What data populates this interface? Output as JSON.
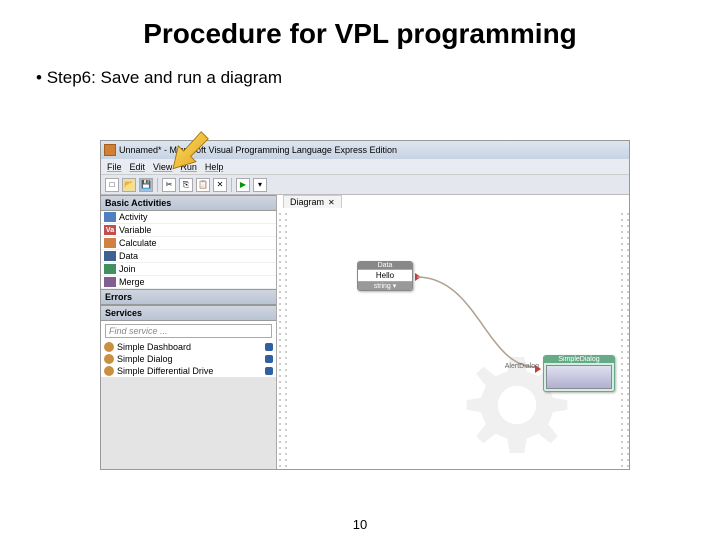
{
  "slide": {
    "title": "Procedure for VPL programming",
    "bullet": "Step6: Save and run a diagram",
    "page_number": "10"
  },
  "app": {
    "window_title": "Unnamed* - Microsoft Visual Programming Language Express Edition",
    "menubar": {
      "file": "File",
      "edit": "Edit",
      "view": "View",
      "run": "Run",
      "help": "Help"
    },
    "toolbar": {
      "new": "□",
      "open": "📂",
      "save": "💾",
      "cut": "✂",
      "copy": "⎘",
      "paste": "📋",
      "delete": "✕",
      "run": "▶"
    },
    "panels": {
      "basic_activities": {
        "header": "Basic Activities",
        "items": [
          {
            "icon_bg": "#5080c0",
            "icon_text": "",
            "label": "Activity"
          },
          {
            "icon_bg": "#c05050",
            "icon_text": "Va",
            "label": "Variable"
          },
          {
            "icon_bg": "#d08040",
            "icon_text": "",
            "label": "Calculate"
          },
          {
            "icon_bg": "#406090",
            "icon_text": "",
            "label": "Data"
          },
          {
            "icon_bg": "#409060",
            "icon_text": "",
            "label": "Join"
          },
          {
            "icon_bg": "#806090",
            "icon_text": "",
            "label": "Merge"
          }
        ]
      },
      "errors": {
        "header": "Errors"
      },
      "services": {
        "header": "Services",
        "search_placeholder": "Find service ...",
        "items": [
          {
            "label": "Simple Dashboard"
          },
          {
            "label": "Simple Dialog"
          },
          {
            "label": "Simple Differential Drive"
          }
        ]
      }
    },
    "canvas": {
      "tab_label": "Diagram",
      "data_node": {
        "header": "Data",
        "value": "Hello",
        "type": "string"
      },
      "dialog_node": {
        "header": "SimpleDialog",
        "port_label": "AlertDialog"
      }
    }
  }
}
